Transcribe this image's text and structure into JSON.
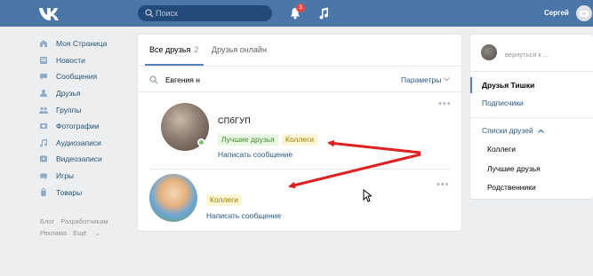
{
  "header": {
    "search_placeholder": "Поиск",
    "notification_count": "3",
    "user_name": "Сергей"
  },
  "menu": {
    "items": [
      {
        "label": "Моя Страница",
        "icon": "home-icon"
      },
      {
        "label": "Новости",
        "icon": "news-icon"
      },
      {
        "label": "Сообщения",
        "icon": "messages-icon"
      },
      {
        "label": "Друзья",
        "icon": "friends-icon"
      },
      {
        "label": "Группы",
        "icon": "groups-icon"
      },
      {
        "label": "Фотографии",
        "icon": "photos-icon"
      },
      {
        "label": "Аудиозаписи",
        "icon": "audio-icon"
      },
      {
        "label": "Видеозаписи",
        "icon": "video-icon"
      },
      {
        "label": "Игры",
        "icon": "games-icon"
      },
      {
        "label": "Товары",
        "icon": "market-icon"
      }
    ],
    "footer": {
      "blog": "Блог",
      "developers": "Разработчикам",
      "ads": "Реклама",
      "more": "Ещё"
    }
  },
  "main": {
    "tabs": {
      "all_label": "Все друзья",
      "all_count": "2",
      "online_label": "Друзья онлайн"
    },
    "filter": {
      "search_value": "Евгения н",
      "params_label": "Параметры"
    },
    "friends": [
      {
        "name": "СПбГУП",
        "online": true,
        "tags": [
          "Лучшие друзья",
          "Коллеги"
        ],
        "message_label": "Написать сообщение"
      },
      {
        "name": "",
        "online": false,
        "tags": [
          "Коллеги"
        ],
        "message_label": "Написать сообщение"
      }
    ],
    "more_glyph": "•••"
  },
  "right_panel": {
    "back_label": "вернуться к ...",
    "friends_of": "Друзья Тишки",
    "subscribers": "Подписчики",
    "lists_label": "Списки друзей",
    "lists": [
      "Коллеги",
      "Лучшие друзья",
      "Родственники"
    ]
  },
  "colors": {
    "header_bg": "#4a76a8",
    "link": "#2a5885",
    "annotation_arrow": "#e02020"
  }
}
